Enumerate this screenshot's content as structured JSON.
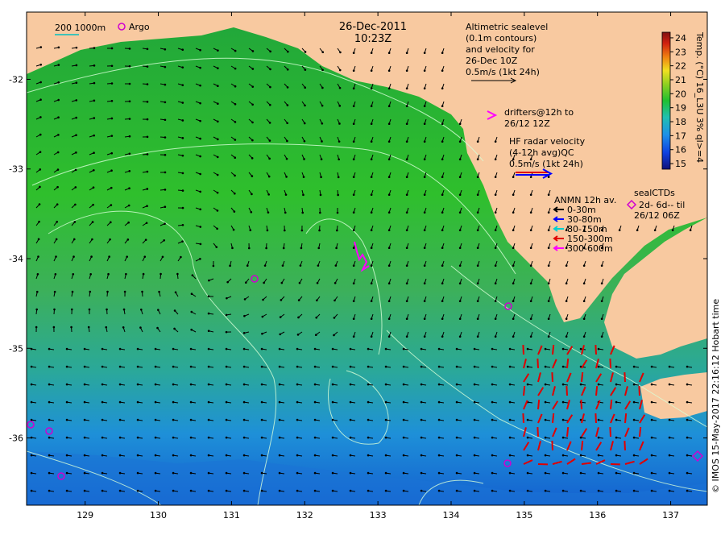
{
  "header": {
    "date": "26-Dec-2011",
    "time": "10:23Z"
  },
  "scale_bar": {
    "depths": "200  1000m",
    "argo_label": "Argo"
  },
  "altimetry": {
    "lines": [
      "Altimetric sealevel",
      "(0.1m contours)",
      "and velocity for",
      "26-Dec 10Z",
      "0.5m/s (1kt 24h)"
    ]
  },
  "drifters": {
    "lines": [
      "drifters@12h to",
      "26/12 12Z"
    ],
    "color": "#ff00ff"
  },
  "hf_radar": {
    "lines": [
      "HF radar velocity",
      "(4-12h avg)QC",
      "0.5m/s (1kt 24h)"
    ],
    "color": "#e00000"
  },
  "anmn": {
    "title": "ANMN 12h av.",
    "bins": [
      {
        "label": "0-30m",
        "color": "#000000"
      },
      {
        "label": "30-80m",
        "color": "#0000ff"
      },
      {
        "label": "80-150m",
        "color": "#00d0d0"
      },
      {
        "label": "150-300m",
        "color": "#e00000"
      },
      {
        "label": "300-600m",
        "color": "#ff00ff"
      }
    ]
  },
  "sealctds": {
    "lines": [
      "sealCTDs",
      "2d- 6d-- til",
      "26/12 06Z"
    ]
  },
  "colorbar": {
    "title": "Temp. (°C) 16_L3U 3% ql>=4",
    "ticks": [
      15,
      16,
      17,
      18,
      19,
      20,
      21,
      22,
      23,
      24
    ],
    "range": [
      14.6,
      24.4
    ]
  },
  "axes": {
    "lon_ticks": [
      129,
      130,
      131,
      132,
      133,
      134,
      135,
      136,
      137
    ],
    "lat_ticks": [
      -32,
      -33,
      -34,
      -35,
      -36
    ],
    "lon_range": [
      128.2,
      137.5
    ],
    "lat_range": [
      -36.75,
      -31.25
    ]
  },
  "credit": "© IMOS 15-May-2017 22:16:12 Hobart time"
}
